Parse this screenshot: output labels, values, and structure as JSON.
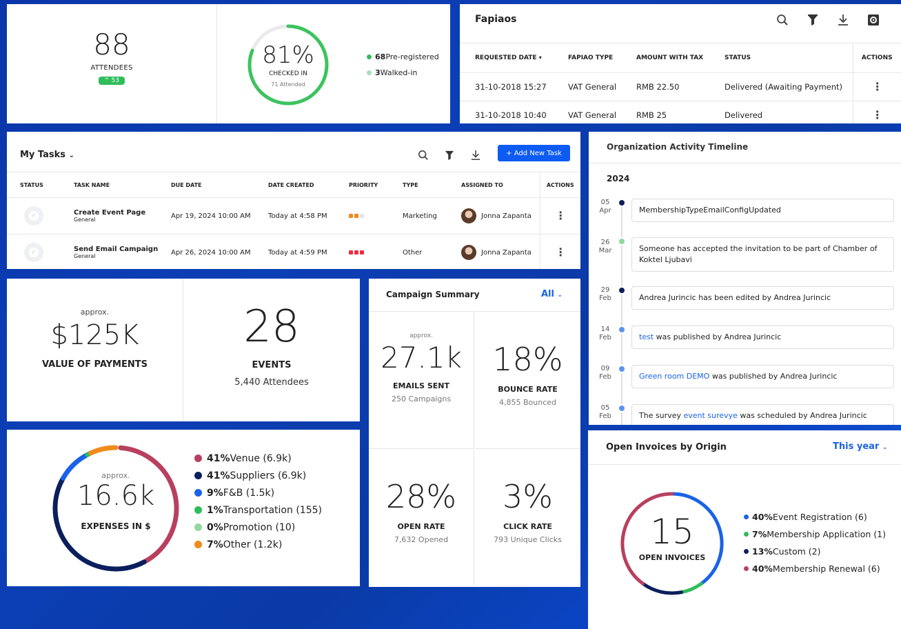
{
  "attendees": {
    "count": "88",
    "label": "ATTENDEES",
    "delta": "^ 53",
    "checked_percent": "81%",
    "checked_fraction": 0.81,
    "checked_label": "CHECKED IN",
    "checked_sub": "71 Attended",
    "legend": [
      {
        "bold": "68",
        "text": " Pre-registered",
        "color": "#2fbd5c"
      },
      {
        "bold": "3",
        "text": " Walked-in",
        "color": "#a6e0b7"
      }
    ]
  },
  "fapiaos": {
    "title": "Fapiaos",
    "columns": [
      "REQUESTED DATE",
      "FAPIAO TYPE",
      "AMOUNT WITH TAX",
      "STATUS",
      "ACTIONS"
    ],
    "sort_indicator": "▾",
    "rows": [
      {
        "date": "31-10-2018 15:27",
        "type": "VAT General",
        "amount": "RMB 22.50",
        "status": "Delivered (Awaiting Payment)"
      },
      {
        "date": "31-10-2018 10:40",
        "type": "VAT General",
        "amount": "RMB 25",
        "status": "Delivered"
      }
    ]
  },
  "tasks": {
    "title": "My Tasks",
    "add_label": "+ Add New Task",
    "columns": [
      "STATUS",
      "TASK NAME",
      "DUE DATE",
      "DATE CREATED",
      "PRIORITY",
      "TYPE",
      "ASSIGNED TO",
      "ACTIONS"
    ],
    "rows": [
      {
        "name": "Create Event Page",
        "sub": "General",
        "due": "Apr 19, 2024 10:00 AM",
        "created": "Today at 4:58 PM",
        "type": "Marketing",
        "assignee": "Jonna Zapanta",
        "priority": [
          "#f08a1c",
          "#f08a1c",
          "#e3e3e8"
        ]
      },
      {
        "name": "Send Email Campaign",
        "sub": "General",
        "due": "Apr 26, 2024 10:00 AM",
        "created": "Today at 4:59 PM",
        "type": "Other",
        "assignee": "Jonna Zapanta",
        "priority": [
          "#e8303f",
          "#e8303f",
          "#e8303f"
        ]
      }
    ]
  },
  "timeline": {
    "title": "Organization Activity Timeline",
    "year": "2024",
    "items": [
      {
        "day": "05",
        "mon": "Apr",
        "color": "#0a1f5c",
        "pre": "",
        "link": "",
        "post": "MembershipTypeEmailConfigUpdated"
      },
      {
        "day": "26",
        "mon": "Mar",
        "color": "#8fd99e",
        "pre": "",
        "link": "",
        "post": "Someone has accepted the invitation to be part of Chamber of Koktel Ljubavi"
      },
      {
        "day": "29",
        "mon": "Feb",
        "color": "#0a1f5c",
        "pre": "",
        "link": "",
        "post": "Andrea Jurincic has been edited by Andrea Jurincic"
      },
      {
        "day": "14",
        "mon": "Feb",
        "color": "#5b93f0",
        "pre": "",
        "link": "test",
        "post": " was published by Andrea Jurincic"
      },
      {
        "day": "09",
        "mon": "Feb",
        "color": "#5b93f0",
        "pre": "",
        "link": "Green room DEMO",
        "post": " was published by Andrea Jurincic"
      },
      {
        "day": "05",
        "mon": "Feb",
        "color": "#5b93f0",
        "pre": "The survey ",
        "link": "event surevye",
        "post": " was scheduled by Andrea Jurincic"
      }
    ]
  },
  "payments": {
    "approx": "approx.",
    "value": "$125K",
    "label": "VALUE OF PAYMENTS",
    "events_value": "28",
    "events_label": "EVENTS",
    "events_sub": "5,440 Attendees"
  },
  "expenses": {
    "approx": "approx.",
    "value": "16.6k",
    "label": "EXPENSES IN $",
    "legend": [
      {
        "pct": "41%",
        "text": " Venue (6.9k)",
        "color": "#b8405e",
        "fraction": 0.41
      },
      {
        "pct": "41%",
        "text": " Suppliers (6.9k)",
        "color": "#0a1f5c",
        "fraction": 0.41
      },
      {
        "pct": "9%",
        "text": " F&B (1.5k)",
        "color": "#1a62e8",
        "fraction": 0.09
      },
      {
        "pct": "1%",
        "text": " Transportation (155)",
        "color": "#2fbd5c",
        "fraction": 0.01
      },
      {
        "pct": "0%",
        "text": " Promotion (10)",
        "color": "#8fd99e",
        "fraction": 0.0
      },
      {
        "pct": "7%",
        "text": " Other (1.2k)",
        "color": "#f08a1c",
        "fraction": 0.07
      }
    ]
  },
  "campaign": {
    "title": "Campaign Summary",
    "filter": "All",
    "cells": [
      {
        "approx": "approx.",
        "value": "27.1k",
        "label": "EMAILS SENT",
        "sub": "250 Campaigns"
      },
      {
        "approx": "",
        "value": "18%",
        "label": "BOUNCE RATE",
        "sub": "4,855 Bounced"
      },
      {
        "approx": "",
        "value": "28%",
        "label": "OPEN RATE",
        "sub": "7,632 Opened"
      },
      {
        "approx": "",
        "value": "3%",
        "label": "CLICK RATE",
        "sub": "793 Unique Clicks"
      }
    ]
  },
  "invoices": {
    "title": "Open Invoices by Origin",
    "filter": "This year",
    "value": "15",
    "label": "OPEN INVOICES",
    "legend": [
      {
        "pct": "40%",
        "text": " Event Registration (6)",
        "color": "#1a62e8",
        "fraction": 0.4
      },
      {
        "pct": "7%",
        "text": " Membership Application (1)",
        "color": "#2fbd5c",
        "fraction": 0.07
      },
      {
        "pct": "13%",
        "text": " Custom (2)",
        "color": "#0a1f5c",
        "fraction": 0.13
      },
      {
        "pct": "40%",
        "text": " Membership Renewal (6)",
        "color": "#b8405e",
        "fraction": 0.4
      }
    ]
  }
}
